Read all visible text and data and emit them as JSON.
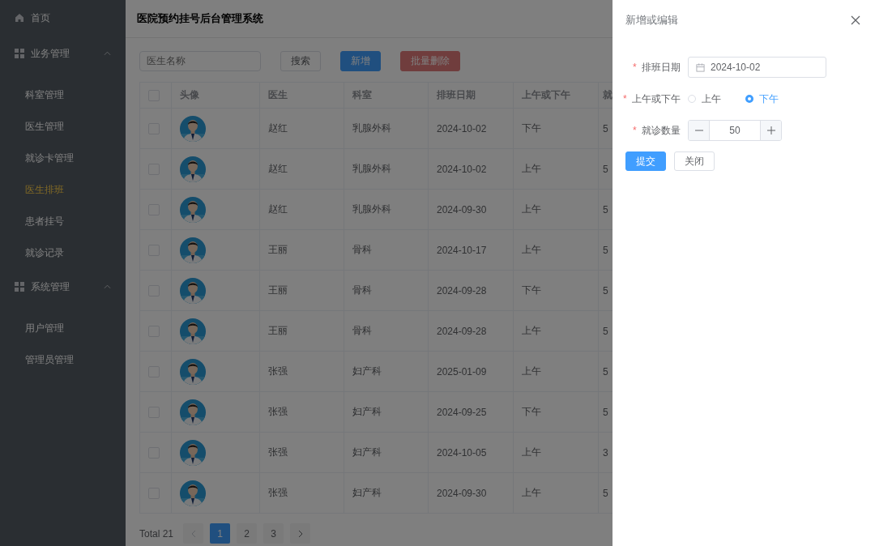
{
  "sidebar": {
    "items": [
      {
        "kind": "link",
        "label": "首页",
        "selected": false
      },
      {
        "kind": "group",
        "label": "业务管理",
        "expanded": true,
        "children": [
          {
            "label": "科室管理",
            "selected": false
          },
          {
            "label": "医生管理",
            "selected": false
          },
          {
            "label": "就诊卡管理",
            "selected": false
          },
          {
            "label": "医生排班",
            "selected": true
          },
          {
            "label": "患者挂号",
            "selected": false
          },
          {
            "label": "就诊记录",
            "selected": false
          }
        ]
      },
      {
        "kind": "group",
        "label": "系统管理",
        "expanded": true,
        "children": [
          {
            "label": "用户管理",
            "selected": false
          },
          {
            "label": "管理员管理",
            "selected": false
          }
        ]
      }
    ]
  },
  "header": {
    "title": "医院预约挂号后台管理系统"
  },
  "toolbar": {
    "search": {
      "placeholder": "医生名称"
    },
    "buttons": [
      {
        "label": "搜索",
        "kind": "default",
        "disabled": false
      },
      {
        "label": "新增",
        "kind": "primary",
        "disabled": false
      },
      {
        "label": "批量删除",
        "kind": "danger",
        "disabled": true
      }
    ]
  },
  "table": {
    "all_checked": false,
    "columns": [
      "头像",
      "医生",
      "科室",
      "排班日期",
      "上午或下午",
      "就"
    ],
    "rows": [
      {
        "checked": false,
        "doctor": "赵红",
        "department": "乳腺外科",
        "date": "2024-10-02",
        "period": "下午",
        "column_7": "5"
      },
      {
        "checked": false,
        "doctor": "赵红",
        "department": "乳腺外科",
        "date": "2024-10-02",
        "period": "上午",
        "column_7": "5"
      },
      {
        "checked": false,
        "doctor": "赵红",
        "department": "乳腺外科",
        "date": "2024-09-30",
        "period": "上午",
        "column_7": "5"
      },
      {
        "checked": false,
        "doctor": "王丽",
        "department": "骨科",
        "date": "2024-10-17",
        "period": "上午",
        "column_7": "5"
      },
      {
        "checked": false,
        "doctor": "王丽",
        "department": "骨科",
        "date": "2024-09-28",
        "period": "下午",
        "column_7": "5"
      },
      {
        "checked": false,
        "doctor": "王丽",
        "department": "骨科",
        "date": "2024-09-28",
        "period": "上午",
        "column_7": "5"
      },
      {
        "checked": false,
        "doctor": "张强",
        "department": "妇产科",
        "date": "2025-01-09",
        "period": "上午",
        "column_7": "5"
      },
      {
        "checked": false,
        "doctor": "张强",
        "department": "妇产科",
        "date": "2024-09-25",
        "period": "下午",
        "column_7": "5"
      },
      {
        "checked": false,
        "doctor": "张强",
        "department": "妇产科",
        "date": "2024-10-05",
        "period": "上午",
        "column_7": "3"
      },
      {
        "checked": false,
        "doctor": "张强",
        "department": "妇产科",
        "date": "2024-09-30",
        "period": "上午",
        "column_7": "5"
      }
    ]
  },
  "pagination": {
    "total": "Total 21",
    "prev_disabled": true,
    "next_disabled": false,
    "pages": [
      {
        "label": "1",
        "selected": true
      },
      {
        "label": "2",
        "selected": false
      },
      {
        "label": "3",
        "selected": false
      }
    ]
  },
  "drawer": {
    "title": "新增或编辑",
    "fields": [
      {
        "kind": "date",
        "label": "排班日期",
        "required_mark": "*",
        "value": "2024-10-02"
      },
      {
        "kind": "radio",
        "label": "上午或下午",
        "required_mark": "*",
        "options": [
          {
            "label": "上午",
            "selected": false
          },
          {
            "label": "下午",
            "selected": true
          }
        ]
      },
      {
        "kind": "number",
        "label": "就诊数量",
        "required_mark": "*",
        "value": "50"
      }
    ],
    "buttons": [
      {
        "label": "提交",
        "kind": "primary"
      },
      {
        "label": "关闭",
        "kind": "default"
      }
    ]
  }
}
